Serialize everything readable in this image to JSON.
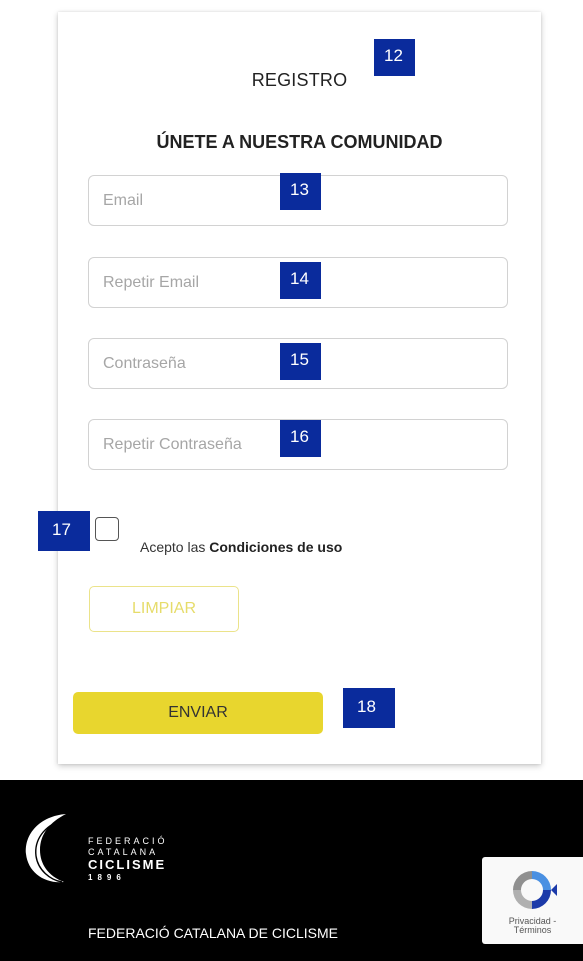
{
  "form": {
    "title": "REGISTRO",
    "subtitle": "ÚNETE A NUESTRA COMUNIDAD",
    "email_placeholder": "Email",
    "repeat_email_placeholder": "Repetir Email",
    "password_placeholder": "Contraseña",
    "repeat_password_placeholder": "Repetir Contraseña",
    "terms_prefix": "Acepto las ",
    "terms_link": "Condiciones de uso",
    "clear_label": "LIMPIAR",
    "submit_label": "ENVIAR"
  },
  "markers": [
    "12",
    "13",
    "14",
    "15",
    "16",
    "17",
    "18"
  ],
  "footer": {
    "logo_line1": "FEDERACIÓ",
    "logo_line2": "CATALANA",
    "logo_line3": "CICLISME",
    "logo_year": "1896",
    "org_name": "FEDERACIÓ CATALANA DE CICLISME"
  },
  "recaptcha": {
    "privacy": "Privacidad",
    "separator": " - ",
    "terms": "Términos"
  },
  "colors": {
    "accent_yellow": "#e8d62e",
    "marker_blue": "#0a2b9c",
    "footer_bg": "#000000"
  }
}
